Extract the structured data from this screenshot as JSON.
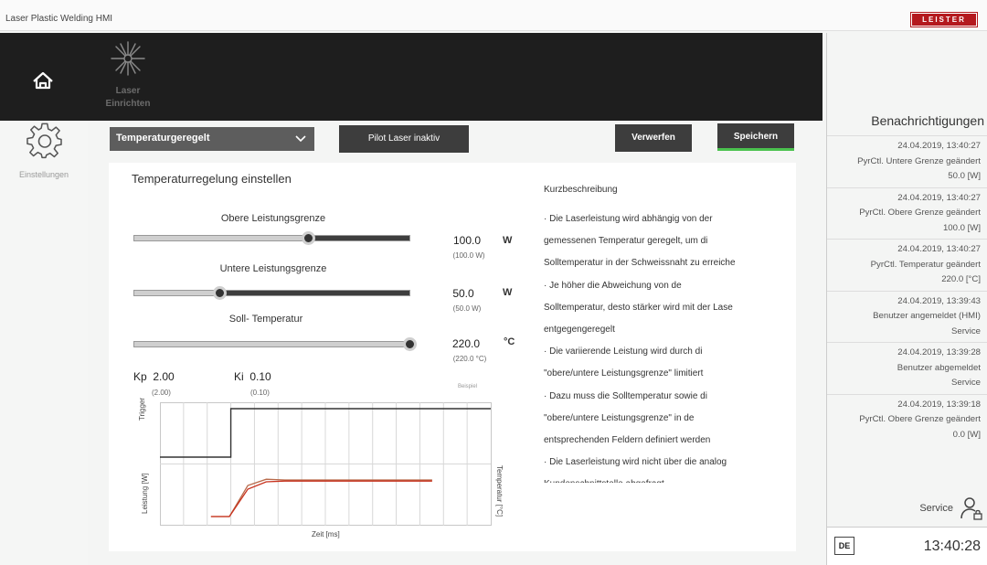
{
  "window": {
    "title": "Laser Plastic Welding HMI",
    "logo_text": "LEISTER"
  },
  "topbar": {
    "laser_label_line1": "Laser",
    "laser_label_line2": "Einrichten"
  },
  "leftnav": {
    "settings_label": "Einstellungen"
  },
  "toolbar": {
    "mode_select": "Temperaturgeregelt",
    "pilot_button": "Pilot Laser inaktiv",
    "discard_button": "Verwerfen",
    "save_button": "Speichern"
  },
  "panel": {
    "title": "Temperaturregelung einstellen",
    "sliders": [
      {
        "label": "Obere Leistungsgrenze",
        "value": "100.0",
        "sub": "(100.0 W)",
        "unit": "W",
        "fraction": 0.63
      },
      {
        "label": "Untere Leistungsgrenze",
        "value": "50.0",
        "sub": "(50.0 W)",
        "unit": "W",
        "fraction": 0.31
      },
      {
        "label": "Soll- Temperatur",
        "value": "220.0",
        "sub": "(220.0 °C)",
        "unit": "°C",
        "fraction": 1.0
      }
    ],
    "kp": {
      "label": "Kp",
      "value": "2.00",
      "sub": "(2.00)"
    },
    "ki": {
      "label": "Ki",
      "value": "0.10",
      "sub": "(0.10)"
    }
  },
  "chart_data": {
    "type": "line",
    "xlabel": "Zeit [ms]",
    "ylabels": {
      "top": "Trigger",
      "bottom_left": "Leistung [W]",
      "bottom_right": "Temperatur [°C]"
    },
    "corner_text": "Beispiel",
    "grid": true,
    "series": [
      {
        "values": [
          0,
          0,
          0,
          1,
          1,
          1,
          1,
          1,
          1,
          1,
          1,
          1,
          1,
          1,
          1
        ],
        "color": "#333333"
      },
      {
        "values": [
          0,
          0,
          0,
          0,
          0.85,
          1.02,
          1,
          1,
          1,
          1,
          1,
          1,
          1,
          1,
          1
        ],
        "color": "#b86a4a"
      },
      {
        "values": [
          0,
          0,
          0,
          0,
          0.75,
          0.95,
          0.97,
          0.97,
          0.97,
          0.97,
          0.97,
          0.97,
          0.97,
          0.97,
          0.97
        ],
        "color": "#c8321e"
      }
    ]
  },
  "description": {
    "heading": "Kurzbeschreibung",
    "lines": [
      "· Die Laserleistung wird abhängig von der",
      "gemessenen Temperatur geregelt, um di",
      "Solltemperatur in der Schweissnaht zu erreiche",
      "· Je höher die Abweichung von de",
      "Solltemperatur, desto stärker wird mit der Lase",
      "entgegengeregelt",
      "· Die variierende Leistung wird durch di",
      "\"obere/untere Leistungsgrenze\" limitiert",
      "· Dazu muss die Solltemperatur sowie di",
      "\"obere/untere Leistungsgrenze\" in de",
      "entsprechenden Feldern definiert werden",
      "· Die Laserleistung wird nicht über die analog",
      "Kundenschnittstelle abgefragt"
    ]
  },
  "notifications": {
    "heading": "Benachrichtigungen",
    "items": [
      {
        "time": "24.04.2019, 13:40:27",
        "text": "PyrCtl. Untere Grenze geändert",
        "value": "50.0 [W]"
      },
      {
        "time": "24.04.2019, 13:40:27",
        "text": "PyrCtl. Obere Grenze geändert",
        "value": "100.0 [W]"
      },
      {
        "time": "24.04.2019, 13:40:27",
        "text": "PyrCtl. Temperatur geändert",
        "value": "220.0 [°C]"
      },
      {
        "time": "24.04.2019, 13:39:43",
        "text": "Benutzer angemeldet (HMI)",
        "value": "Service"
      },
      {
        "time": "24.04.2019, 13:39:28",
        "text": "Benutzer abgemeldet",
        "value": "Service"
      },
      {
        "time": "24.04.2019, 13:39:18",
        "text": "PyrCtl. Obere Grenze geändert",
        "value": "0.0 [W]"
      }
    ]
  },
  "footer": {
    "user": "Service",
    "language": "DE",
    "clock": "13:40:28"
  }
}
